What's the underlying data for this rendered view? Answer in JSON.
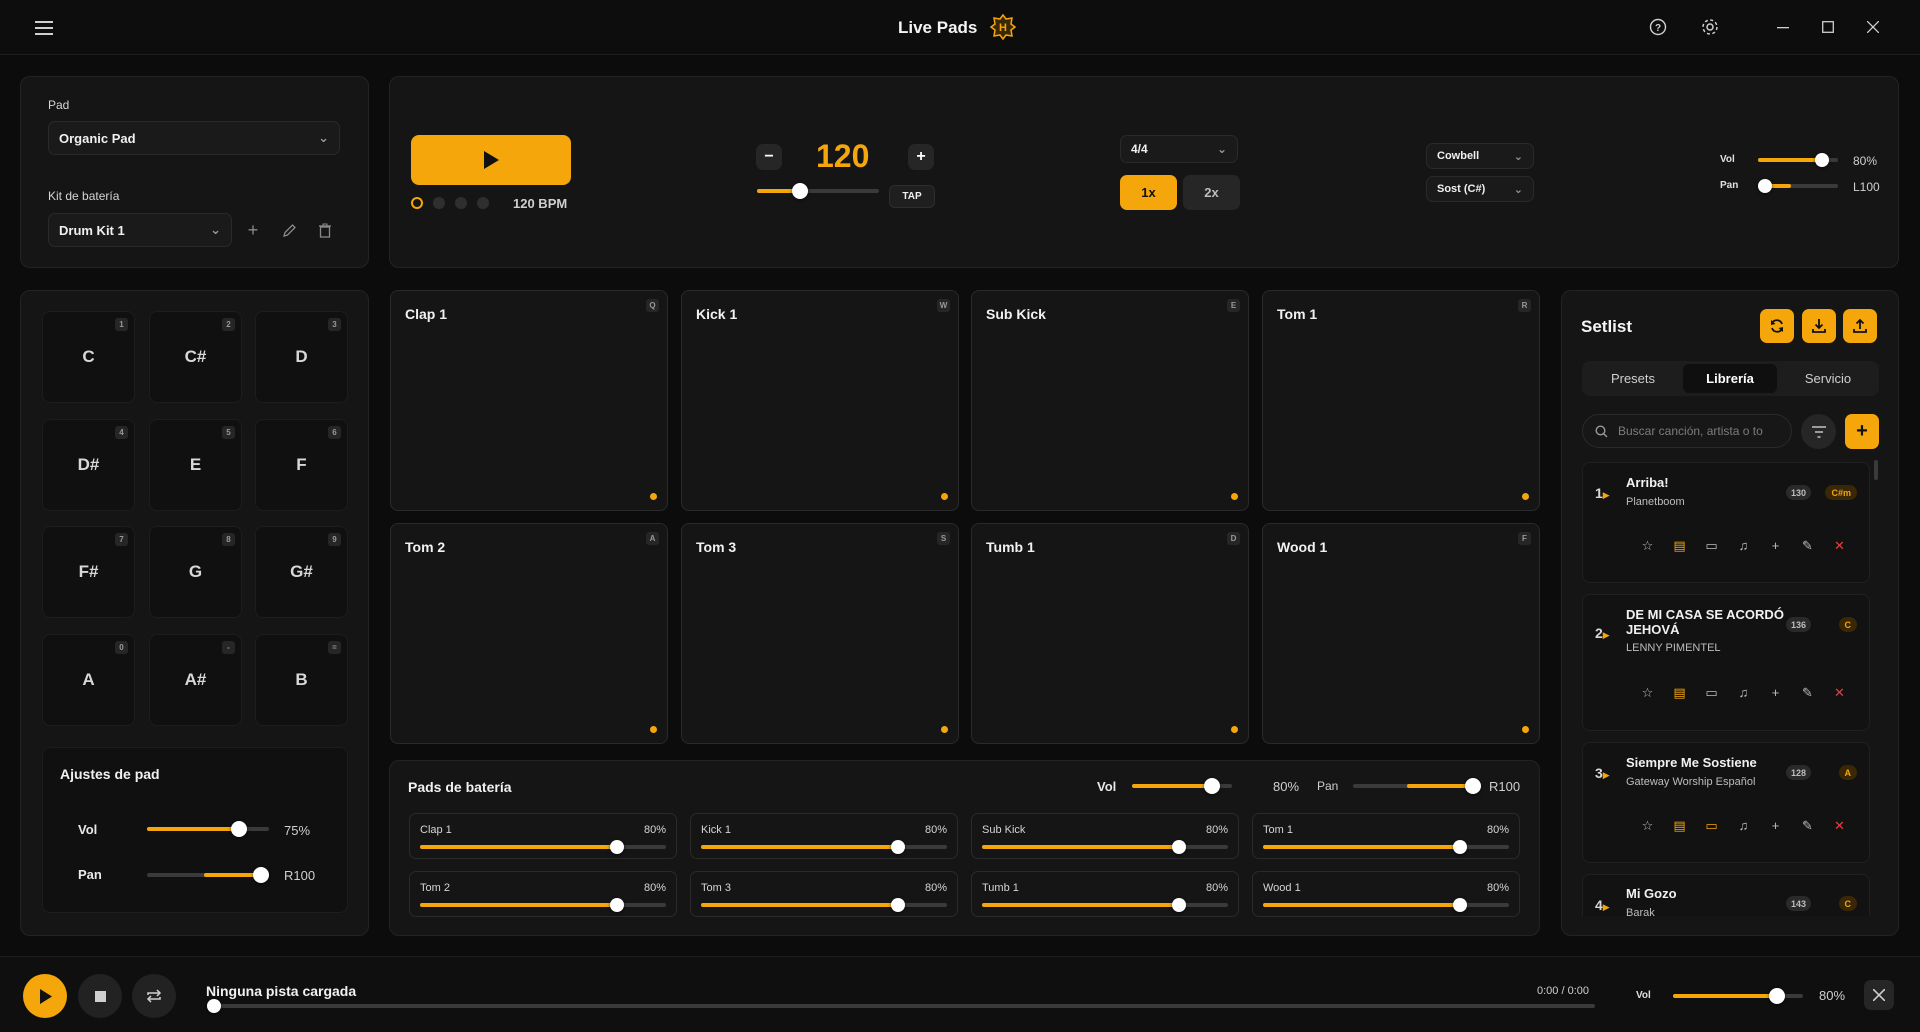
{
  "app": {
    "title": "Live Pads"
  },
  "titlebar": {
    "icons": [
      "menu-icon",
      "help-icon",
      "gear-icon",
      "minimize-icon",
      "maximize-icon",
      "close-icon"
    ]
  },
  "pad_selector": {
    "pad_label": "Pad",
    "pad_value": "Organic Pad",
    "kit_label": "Kit de batería",
    "kit_value": "Drum Kit 1"
  },
  "transport": {
    "bpm": "120",
    "bpm_caption": "120 BPM",
    "tap_label": "TAP",
    "tempo_fraction": 0.35,
    "time_signature": "4/4",
    "speed_1x": "1x",
    "speed_2x": "2x",
    "sound_1": "Cowbell",
    "sound_2": "Sost (C#)",
    "vol_label": "Vol",
    "vol_value": "80%",
    "vol_fraction": 0.8,
    "pan_label": "Pan",
    "pan_value": "L100",
    "pan_fraction": 0.0
  },
  "keys": [
    {
      "note": "C",
      "hotkey": "1"
    },
    {
      "note": "C#",
      "hotkey": "2"
    },
    {
      "note": "D",
      "hotkey": "3"
    },
    {
      "note": "D#",
      "hotkey": "4"
    },
    {
      "note": "E",
      "hotkey": "5"
    },
    {
      "note": "F",
      "hotkey": "6"
    },
    {
      "note": "F#",
      "hotkey": "7"
    },
    {
      "note": "G",
      "hotkey": "8"
    },
    {
      "note": "G#",
      "hotkey": "9"
    },
    {
      "note": "A",
      "hotkey": "0"
    },
    {
      "note": "A#",
      "hotkey": "-"
    },
    {
      "note": "B",
      "hotkey": "="
    }
  ],
  "pad_settings": {
    "title": "Ajustes de pad",
    "vol_label": "Vol",
    "vol_value": "75%",
    "vol_fraction": 0.75,
    "pan_label": "Pan",
    "pan_value": "R100",
    "pan_fraction": 1.0
  },
  "drum_pads": [
    {
      "name": "Clap 1",
      "hotkey": "Q"
    },
    {
      "name": "Kick 1",
      "hotkey": "W"
    },
    {
      "name": "Sub Kick",
      "hotkey": "E"
    },
    {
      "name": "Tom 1",
      "hotkey": "R"
    },
    {
      "name": "Tom 2",
      "hotkey": "A"
    },
    {
      "name": "Tom 3",
      "hotkey": "S"
    },
    {
      "name": "Tumb 1",
      "hotkey": "D"
    },
    {
      "name": "Wood 1",
      "hotkey": "F"
    }
  ],
  "drum_mixer": {
    "title": "Pads de batería",
    "vol_label": "Vol",
    "vol_value": "80%",
    "vol_fraction": 0.8,
    "pan_label": "Pan",
    "pan_value": "R100",
    "pan_fraction": 1.0,
    "channels": [
      {
        "name": "Clap 1",
        "value": "80%",
        "fraction": 0.8
      },
      {
        "name": "Kick 1",
        "value": "80%",
        "fraction": 0.8
      },
      {
        "name": "Sub Kick",
        "value": "80%",
        "fraction": 0.8
      },
      {
        "name": "Tom 1",
        "value": "80%",
        "fraction": 0.8
      },
      {
        "name": "Tom 2",
        "value": "80%",
        "fraction": 0.8
      },
      {
        "name": "Tom 3",
        "value": "80%",
        "fraction": 0.8
      },
      {
        "name": "Tumb 1",
        "value": "80%",
        "fraction": 0.8
      },
      {
        "name": "Wood 1",
        "value": "80%",
        "fraction": 0.8
      }
    ]
  },
  "setlist": {
    "title": "Setlist",
    "tabs": [
      "Presets",
      "Librería",
      "Servicio"
    ],
    "active_tab": "Librería",
    "search_placeholder": "Buscar canción, artista o to",
    "songs": [
      {
        "num": "1",
        "title": "Arriba!",
        "artist": "Planetboom",
        "bpm": "130",
        "key": "C#m"
      },
      {
        "num": "2",
        "title": "DE MI CASA SE ACORDÓ JEHOVÁ",
        "artist": "LENNY PIMENTEL",
        "bpm": "136",
        "key": "C"
      },
      {
        "num": "3",
        "title": "Siempre Me Sostiene",
        "artist": "Gateway Worship Español",
        "bpm": "128",
        "key": "A"
      },
      {
        "num": "4",
        "title": "Mi Gozo",
        "artist": "Barak",
        "bpm": "143",
        "key": "C"
      }
    ]
  },
  "player": {
    "track": "Ninguna pista cargada",
    "time": "0:00 / 0:00",
    "progress_fraction": 0.0,
    "vol_label": "Vol",
    "vol_value": "80%",
    "vol_fraction": 0.8
  },
  "colors": {
    "accent": "#f5a60b",
    "background": "#0c0c0c",
    "panel": "#151515"
  }
}
